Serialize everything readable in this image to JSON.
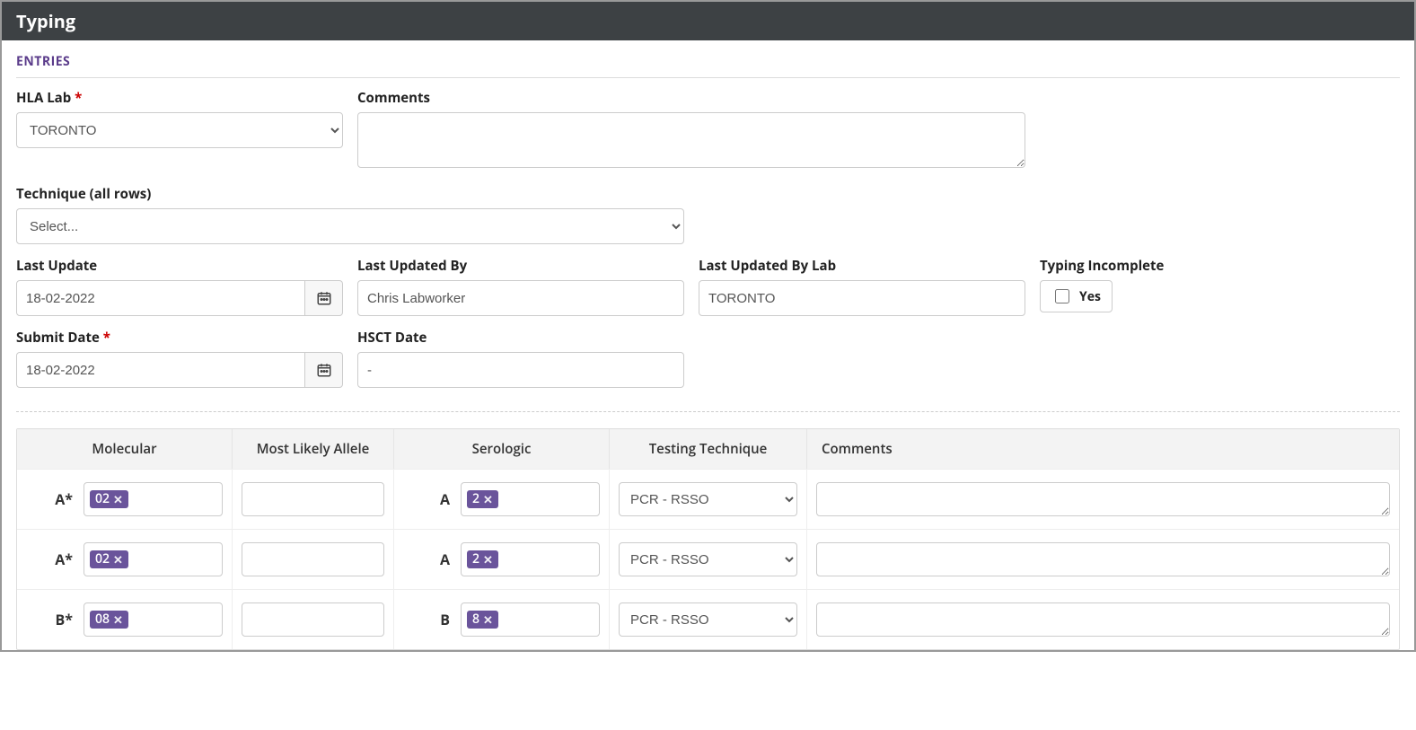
{
  "panel": {
    "title": "Typing",
    "section": "ENTRIES"
  },
  "form": {
    "hla_lab": {
      "label": "HLA Lab",
      "value": "TORONTO"
    },
    "comments": {
      "label": "Comments",
      "value": ""
    },
    "technique_all": {
      "label": "Technique (all rows)",
      "placeholder": "Select..."
    },
    "last_update": {
      "label": "Last Update",
      "value": "18-02-2022"
    },
    "last_updated_by": {
      "label": "Last Updated By",
      "value": "Chris Labworker"
    },
    "last_updated_by_lab": {
      "label": "Last Updated By Lab",
      "value": "TORONTO"
    },
    "typing_incomplete": {
      "label": "Typing Incomplete",
      "option": "Yes",
      "checked": false
    },
    "submit_date": {
      "label": "Submit Date",
      "value": "18-02-2022"
    },
    "hsct_date": {
      "label": "HSCT Date",
      "value": "-"
    }
  },
  "table": {
    "headers": {
      "molecular": "Molecular",
      "allele": "Most Likely Allele",
      "serologic": "Serologic",
      "technique": "Testing Technique",
      "comments": "Comments"
    },
    "technique_option": "PCR - RSSO",
    "rows": [
      {
        "mol_locus": "A*",
        "mol_tag": "02",
        "ser_locus": "A",
        "ser_tag": "2",
        "technique": "PCR - RSSO"
      },
      {
        "mol_locus": "A*",
        "mol_tag": "02",
        "ser_locus": "A",
        "ser_tag": "2",
        "technique": "PCR - RSSO"
      },
      {
        "mol_locus": "B*",
        "mol_tag": "08",
        "ser_locus": "B",
        "ser_tag": "8",
        "technique": "PCR - RSSO"
      }
    ]
  }
}
